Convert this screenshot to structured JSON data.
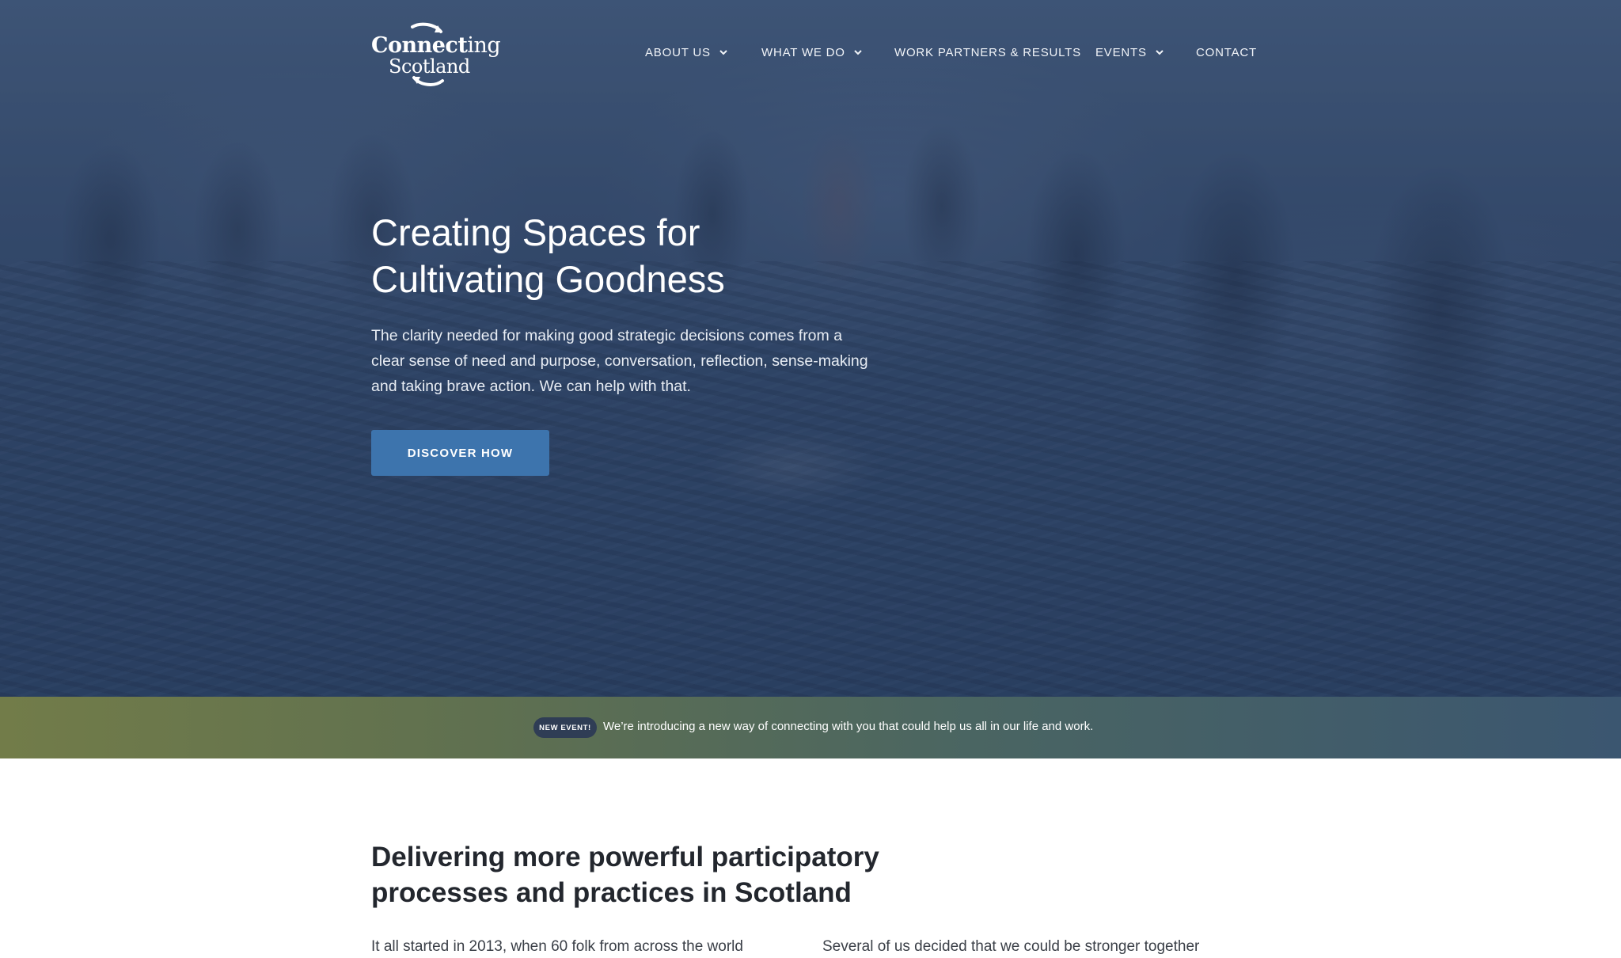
{
  "brand": {
    "logo_word1_bold": "Connect",
    "logo_word1_thin": "ing",
    "logo_word2": "Scotland"
  },
  "nav": {
    "items": [
      {
        "label": "ABOUT US",
        "has_dropdown": true
      },
      {
        "label": "WHAT WE DO",
        "has_dropdown": true
      },
      {
        "label": "WORK PARTNERS & RESULTS",
        "has_dropdown": false
      },
      {
        "label": "EVENTS",
        "has_dropdown": true
      },
      {
        "label": "CONTACT",
        "has_dropdown": false
      }
    ],
    "chevron_icon": "chevron-down-icon"
  },
  "hero": {
    "title_line1": "Creating Spaces for",
    "title_line2": "Cultivating Goodness",
    "text": "The clarity needed for making good strategic decisions comes from a clear sense of need and purpose, conversation, reflection, sense-making and taking brave action. We can help with that.",
    "cta_label": "DISCOVER HOW"
  },
  "announcement": {
    "badge": "NEW EVENT!",
    "text": "We’re introducing a new way of connecting with you that could help us all in our life and work."
  },
  "intro": {
    "title_line1": "Delivering more powerful participatory",
    "title_line2": "processes and practices in Scotland",
    "col1_text": "It all started in 2013, when 60 folk from across the world",
    "col2_text": "Several of us decided that we could be stronger together"
  },
  "colors": {
    "cta": "#3d74ad",
    "badge": "#2f3d55",
    "announce_start": "#727c49",
    "announce_end": "#3b5670"
  }
}
